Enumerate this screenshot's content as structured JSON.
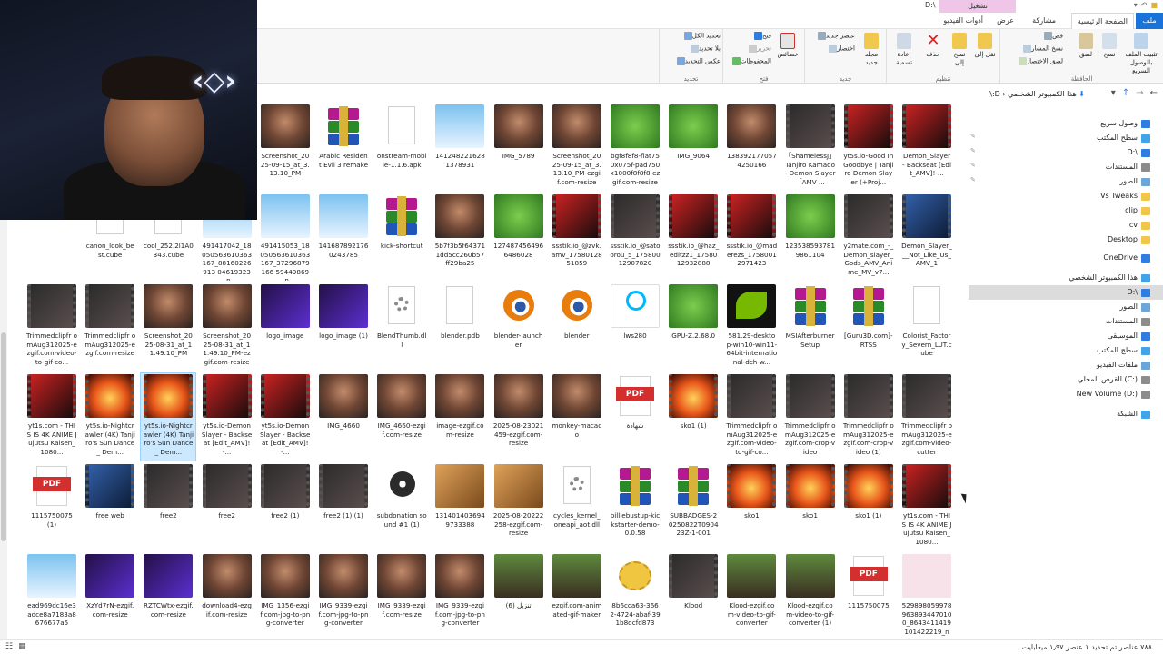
{
  "window": {
    "title": "D:\\",
    "context_tab_label": "تشغيل",
    "qa_icons": [
      "folder-icon",
      "undo-icon",
      "dropdown-icon"
    ]
  },
  "tabs": [
    {
      "label": "ملف",
      "active": false,
      "accent": "#1a73d9"
    },
    {
      "label": "الصفحة الرئيسية",
      "active": true
    },
    {
      "label": "مشاركة",
      "active": false
    },
    {
      "label": "عرض",
      "active": false
    },
    {
      "label": "أدوات الفيديو",
      "active": false
    }
  ],
  "ribbon": {
    "clipboard": {
      "label": "الحافظة",
      "pin": "تثبيت الملف بالوصول السريع",
      "copy": "نسخ",
      "paste": "لصق",
      "cut": "قص",
      "copy_path": "نسخ المسار",
      "paste_shortcut": "لصق الاختصار"
    },
    "organize": {
      "label": "تنظيم",
      "move_to": "نقل إلى",
      "copy_to": "نسخ إلى",
      "delete": "حذف",
      "rename": "إعادة تسمية"
    },
    "new": {
      "label": "جديد",
      "new_folder": "مجلد جديد",
      "new_item": "عنصر جديد",
      "easy_access": "اختصار"
    },
    "open": {
      "label": "فتح",
      "properties": "خصائص",
      "open": "فتح",
      "edit": "تحرير",
      "history": "المحفوظات"
    },
    "select": {
      "label": "تحديد",
      "select_all": "تحديد الكل",
      "select_none": "بلا تحديد",
      "invert": "عكس التحديد"
    }
  },
  "address": {
    "path": [
      "هذا الكمبيوتر الشخصي",
      "D:\\"
    ],
    "separator": "‹"
  },
  "navpane": [
    {
      "label": "وصول سريع",
      "icon": "star-icon",
      "color": "#2f7de1"
    },
    {
      "label": "سطح المكتب",
      "icon": "desktop-icon",
      "color": "#3fa4e8"
    },
    {
      "label": "D:\\",
      "icon": "download-icon",
      "color": "#2f7de1"
    },
    {
      "label": "المستندات",
      "icon": "documents-icon",
      "color": "#8c8c8c"
    },
    {
      "label": "الصور",
      "icon": "pictures-icon",
      "color": "#6aa6d8"
    },
    {
      "label": "Vs Tweaks",
      "icon": "folder-icon",
      "color": "#f3c64a"
    },
    {
      "label": "clip",
      "icon": "folder-icon",
      "color": "#f3c64a"
    },
    {
      "label": "cv",
      "icon": "folder-icon",
      "color": "#f3c64a"
    },
    {
      "label": "Desktop",
      "icon": "folder-icon",
      "color": "#f3c64a"
    },
    {
      "label": "OneDrive",
      "icon": "cloud-icon",
      "color": "#2f7de1"
    },
    {
      "label": "هذا الكمبيوتر الشخصي",
      "icon": "computer-icon",
      "color": "#3fa4e8"
    },
    {
      "label": "D:\\",
      "icon": "download-icon",
      "color": "#2f7de1",
      "selected": true
    },
    {
      "label": "الصور",
      "icon": "pictures-icon",
      "color": "#6aa6d8"
    },
    {
      "label": "المستندات",
      "icon": "documents-icon",
      "color": "#8c8c8c"
    },
    {
      "label": "الموسيقى",
      "icon": "music-icon",
      "color": "#2f7de1"
    },
    {
      "label": "سطح المكتب",
      "icon": "desktop-icon",
      "color": "#3fa4e8"
    },
    {
      "label": "ملفات الفيديو",
      "icon": "video-icon",
      "color": "#6aa6d8"
    },
    {
      "label": "القرص المحلي (C:)",
      "icon": "drive-icon",
      "color": "#8c8c8c"
    },
    {
      "label": "New Volume (D:)",
      "icon": "drive-icon",
      "color": "#8c8c8c"
    },
    {
      "label": "الشبكة",
      "icon": "network-icon",
      "color": "#3fa4e8"
    }
  ],
  "files": [
    [
      {
        "name": "Demon_Slayer - Backseat [Edit_AMV]!-...",
        "kind": "video-red"
      },
      {
        "name": "yt5s.io-Good In Goodbye | Tanjiro Demon Slayer (+Proj...",
        "kind": "video-red"
      },
      {
        "name": "「ShamelessJ」Tanjiro Kamado - Demon Slayer「AMV ...",
        "kind": "video-dark"
      },
      {
        "name": "1383921770574250166",
        "kind": "img-monkey"
      },
      {
        "name": "IMG_9064",
        "kind": "img-pepe"
      },
      {
        "name": "bgf8f8f8-flat750x075f-pad750x1000f8f8f8-ezgif.com-resize",
        "kind": "img-pepe"
      },
      {
        "name": "Screenshot_2025-09-15_at_3.13.10_PM-ezgif.com-resize",
        "kind": "img-person"
      },
      {
        "name": "IMG_5789",
        "kind": "img-person"
      },
      {
        "name": "1412482216281378931",
        "kind": "img-sky"
      },
      {
        "name": "onstream-mobile-1.1.6.apk",
        "kind": "doc"
      },
      {
        "name": "Arabic Resident Evil 3 remake",
        "kind": "rar"
      },
      {
        "name": "Screenshot_2025-09-15_at_3.13.10_PM",
        "kind": "img-person"
      }
    ],
    [
      {
        "name": "Demon_Slayer___Not_Like_Us_AMV_1",
        "kind": "video-blue"
      },
      {
        "name": "y2mate.com_-_Demon_slayer_Gods_AMV_Anime_MV_v7...",
        "kind": "video-dark"
      },
      {
        "name": "1235385937819861104",
        "kind": "img-pepe"
      },
      {
        "name": "ssstik.io_@maderezs_17580012971423",
        "kind": "video-red"
      },
      {
        "name": "ssstik.io_@haz_editzz1_1758012932888",
        "kind": "video-red"
      },
      {
        "name": "ssstik.io_@satoorou_5_17580012907820",
        "kind": "video-dark"
      },
      {
        "name": "ssstik.io_@zvk.amv_1758012851859",
        "kind": "video-red"
      },
      {
        "name": "1274874564966486028",
        "kind": "img-pepe"
      },
      {
        "name": "5b7f3b5f643711dd5cc260b57ff29ba25",
        "kind": "img-person"
      },
      {
        "name": "kick-shortcut",
        "kind": "rar"
      },
      {
        "name": "1416878921760243785",
        "kind": "img-sky"
      },
      {
        "name": "491415053_18050563610363167_37296879166 59449869_n",
        "kind": "img-sky"
      },
      {
        "name": "491417042_18050563610363167_88160226913 04619323_n",
        "kind": "img-sky"
      },
      {
        "name": "cool_252.2l1A0343.cube",
        "kind": "doc"
      },
      {
        "name": "canon_look_best.cube",
        "kind": "doc"
      }
    ],
    [
      {
        "name": "Colorist_Factory_Severn_LUT.cube",
        "kind": "doc"
      },
      {
        "name": "[Guru3D.com]-RTSS",
        "kind": "rar"
      },
      {
        "name": "MSIAfterburnerSetup",
        "kind": "rar"
      },
      {
        "name": "581.29-desktop-win10-win11-64bit-international-dch-w...",
        "kind": "nvidia"
      },
      {
        "name": "GPU-Z.2.68.0",
        "kind": "green"
      },
      {
        "name": "lws280",
        "kind": "logi"
      },
      {
        "name": "blender",
        "kind": "blender"
      },
      {
        "name": "blender-launcher",
        "kind": "blender"
      },
      {
        "name": "blender.pdb",
        "kind": "doc"
      },
      {
        "name": "BlendThumb.dll",
        "kind": "gear"
      },
      {
        "name": "logo_image (1)",
        "kind": "purple"
      },
      {
        "name": "logo_image",
        "kind": "purple"
      },
      {
        "name": "Screenshot_2025-08-31_at_11.49.10_PM-ezgif.com-resize",
        "kind": "img-person"
      },
      {
        "name": "Screenshot_2025-08-31_at_11.49.10_PM",
        "kind": "img-person"
      },
      {
        "name": "Trimmedclipfr omAug312025-ezgif.com-resize",
        "kind": "video-dark"
      },
      {
        "name": "Trimmedclipfr omAug312025-ezgif.com-video-to-gif-co...",
        "kind": "video-dark"
      }
    ],
    [
      {
        "name": "Trimmedclipfr omAug312025-ezgif.com-video-cutter",
        "kind": "video-dark"
      },
      {
        "name": "Trimmedclipfr omAug312025-ezgif.com-crop-video (1)",
        "kind": "video-dark"
      },
      {
        "name": "Trimmedclipfr omAug312025-ezgif.com-crop-video",
        "kind": "video-dark"
      },
      {
        "name": "Trimmedclipfr omAug312025-ezgif.com-video-to-gif-co...",
        "kind": "video-dark"
      },
      {
        "name": "sko1 (1)",
        "kind": "video-fire"
      },
      {
        "name": "شهادة",
        "kind": "pdf"
      },
      {
        "name": "monkey-macaco",
        "kind": "img-person"
      },
      {
        "name": "2025-08-23021459-ezgif.com-resize",
        "kind": "img-person"
      },
      {
        "name": "image-ezgif.com-resize",
        "kind": "img-person"
      },
      {
        "name": "IMG_4660-ezgif.com-resize",
        "kind": "img-person"
      },
      {
        "name": "IMG_4660",
        "kind": "img-person"
      },
      {
        "name": "yt5s.io-Demon Slayer - Backseat [Edit_AMV]!-...",
        "kind": "video-red"
      },
      {
        "name": "yt5s.io-Demon Slayer - Backseat [Edit_AMV]!-...",
        "kind": "video-red"
      },
      {
        "name": "yt5s.io-Nightcrawler (4K) Tanjiro's Sun Dance _ Dem...",
        "kind": "video-fire",
        "selected": true
      },
      {
        "name": "yt5s.io-Nightcrawler (4K) Tanjiro's Sun Dance _ Dem...",
        "kind": "video-fire"
      },
      {
        "name": "yt1s.com - THIS IS 4K ANIME Jujutsu Kaisen_1080...",
        "kind": "video-red"
      }
    ],
    [
      {
        "name": "yt1s.com - THIS IS 4K ANIME Jujutsu Kaisen_1080...",
        "kind": "video-red"
      },
      {
        "name": "sko1 (1)",
        "kind": "video-fire"
      },
      {
        "name": "sko1",
        "kind": "video-fire"
      },
      {
        "name": "sko1",
        "kind": "video-fire"
      },
      {
        "name": "SUBBADGES-20250822T090423Z-1-001",
        "kind": "rar"
      },
      {
        "name": "billiebustup-kickstarter-demo-0.0.58",
        "kind": "rar"
      },
      {
        "name": "cycles_kernel_oneapi_aot.dll",
        "kind": "gear"
      },
      {
        "name": "2025-08-20222258-ezgif.com-resize",
        "kind": "img-cat"
      },
      {
        "name": "1314014036949733388",
        "kind": "img-cat"
      },
      {
        "name": "subdonation sound #1 (1)",
        "kind": "cd"
      },
      {
        "name": "free2 (1) (1)",
        "kind": "video-dark"
      },
      {
        "name": "free2 (1)",
        "kind": "video-dark"
      },
      {
        "name": "free2",
        "kind": "video-dark"
      },
      {
        "name": "free2",
        "kind": "video-dark"
      },
      {
        "name": "free web",
        "kind": "video-blue"
      },
      {
        "name": "1115750075 (1)",
        "kind": "pdf"
      }
    ],
    [
      {
        "name": "5298980599789638934470100_8643411419101422219_n",
        "kind": "pink"
      },
      {
        "name": "1115750075",
        "kind": "pdf"
      },
      {
        "name": "Klood-ezgif.com-video-to-gif-converter (1)",
        "kind": "sheep"
      },
      {
        "name": "Klood-ezgif.com-video-to-gif-converter",
        "kind": "sheep"
      },
      {
        "name": "Klood",
        "kind": "video-dark"
      },
      {
        "name": "8b6cca63-3662-4724-abaf-391b8dcfd873",
        "kind": "sticker"
      },
      {
        "name": "ezgif.com-animated-gif-maker",
        "kind": "sheep"
      },
      {
        "name": "تنزيل (6)",
        "kind": "sheep"
      },
      {
        "name": "IMG_9339-ezgif.com-jpg-to-png-converter",
        "kind": "img-person"
      },
      {
        "name": "IMG_9339-ezgif.com-resize",
        "kind": "img-person"
      },
      {
        "name": "IMG_9339-ezgif.com-jpg-to-png-converter",
        "kind": "img-person"
      },
      {
        "name": "IMG_1356-ezgif.com-jpg-to-png-converter",
        "kind": "img-person"
      },
      {
        "name": "download4-ezgif.com-resize",
        "kind": "img-person"
      },
      {
        "name": "RZTCWtx-ezgif.com-resize",
        "kind": "purple"
      },
      {
        "name": "XzYd7rN-ezgif.com-resize",
        "kind": "purple"
      },
      {
        "name": "ead969dc16e3adce8a7183a8676677a5",
        "kind": "img-sky"
      }
    ]
  ],
  "status": {
    "text": "٧٨٨ عناصر   تم تحديد ١ عنصر ١٫٩٧ ميغابايت"
  },
  "webcam": {
    "logo": "‹◇›"
  }
}
